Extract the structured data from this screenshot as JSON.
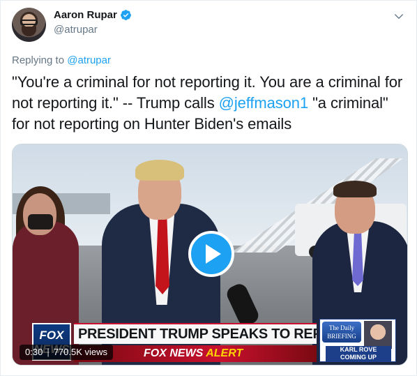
{
  "tweet": {
    "author": {
      "display_name": "Aaron Rupar",
      "handle": "@atrupar",
      "verified": true
    },
    "reply": {
      "prefix": "Replying to ",
      "mention": "@atrupar"
    },
    "text": {
      "part1": "\"You're a criminal for not reporting it. You are a criminal for not reporting it.\" -- Trump calls ",
      "mention": "@jeffmason1",
      "part2": " \"a criminal\" for not reporting on Hunter Biden's emails"
    },
    "video": {
      "duration": "0:30",
      "separator": "|",
      "views": "770.5K views",
      "chyron": {
        "network_logo": "FOX NEWS",
        "headline": "PRESIDENT TRUMP SPEAKS TO REPORTERS",
        "alert_brand": "FOX NEWS",
        "alert_word": "ALERT",
        "briefing_logo": "The Daily BRIEFING",
        "briefing_name": "KARL ROVE",
        "briefing_status": "COMING UP"
      }
    }
  },
  "colors": {
    "link_blue": "#1da1f2",
    "secondary_gray": "#657786",
    "fox_red": "#c8102e",
    "fox_blue": "#0b3a80"
  },
  "icons": [
    "verified-badge-icon",
    "chevron-down-icon",
    "play-icon"
  ]
}
